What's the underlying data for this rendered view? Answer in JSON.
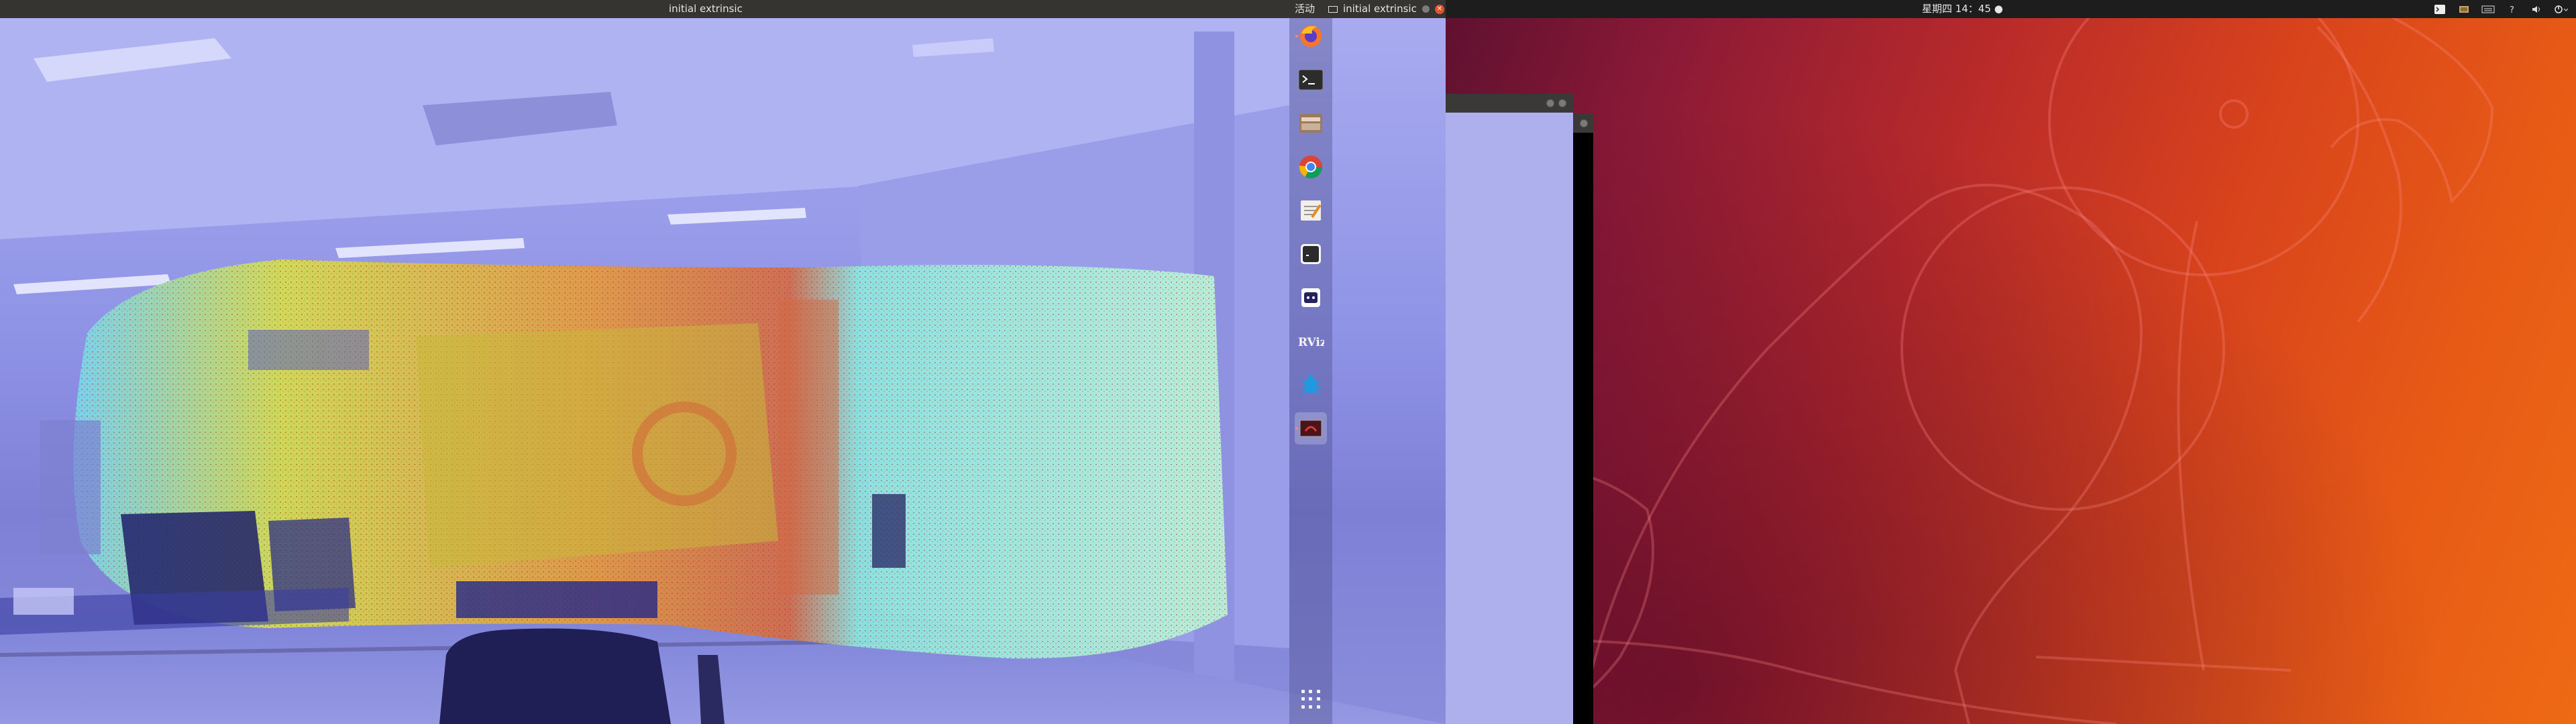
{
  "left_topbar": {
    "window_title": "initial extrinsic",
    "activities_label": "活动",
    "app_menu_label": "initial extrinsic"
  },
  "right_topbar": {
    "clock": "星期四 14：45 ●",
    "tray_icons": [
      "terminal-icon",
      "keyboard-icon",
      "input-method-icon",
      "help-icon",
      "volume-icon",
      "power-icon"
    ]
  },
  "dock": {
    "apps": [
      {
        "name": "firefox-icon",
        "running": true
      },
      {
        "name": "terminal-icon",
        "running": false
      },
      {
        "name": "files-icon",
        "running": false
      },
      {
        "name": "chrome-icon",
        "running": false
      },
      {
        "name": "text-editor-icon",
        "running": false
      },
      {
        "name": "terminal-alt-icon",
        "running": false
      },
      {
        "name": "qt-creator-icon",
        "running": false
      },
      {
        "name": "rviz-icon",
        "running": false
      },
      {
        "name": "bug-icon",
        "running": false
      },
      {
        "name": "calibration-window-icon",
        "running": true,
        "active": true
      }
    ],
    "rviz_label": "RViz"
  },
  "colors": {
    "topbar_left": "#353431",
    "topbar_right": "#1d1d1d",
    "close_button": "#e3522c",
    "viewer_tint": "#8f93e6"
  }
}
